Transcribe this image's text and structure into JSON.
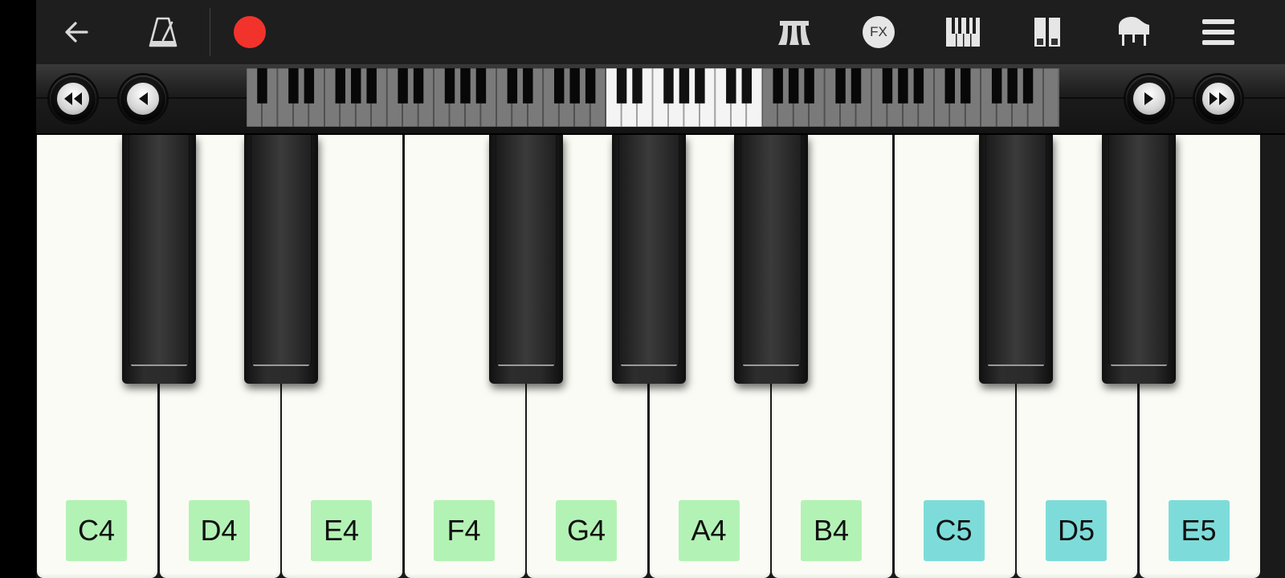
{
  "toolbar": {
    "left": [
      {
        "name": "back-arrow-icon"
      },
      {
        "name": "metronome-icon"
      },
      {
        "name": "record-button"
      }
    ],
    "right": [
      {
        "name": "pedal-sustain-icon"
      },
      {
        "name": "fx-icon",
        "label": "FX"
      },
      {
        "name": "keyboard-layout-icon"
      },
      {
        "name": "dual-keyboard-icon"
      },
      {
        "name": "grand-piano-icon"
      },
      {
        "name": "menu-icon"
      }
    ],
    "record_color": "#f2332c"
  },
  "navigator": {
    "buttons": [
      "rewind-fast",
      "rewind",
      "forward",
      "forward-fast"
    ],
    "visible_octave_range": [
      "C4",
      "E5"
    ]
  },
  "keyboard": {
    "white_keys": [
      {
        "note": "C4",
        "color": "#b3f2b5"
      },
      {
        "note": "D4",
        "color": "#b3f2b5"
      },
      {
        "note": "E4",
        "color": "#b3f2b5"
      },
      {
        "note": "F4",
        "color": "#b3f2b5"
      },
      {
        "note": "G4",
        "color": "#b3f2b5"
      },
      {
        "note": "A4",
        "color": "#b3f2b5"
      },
      {
        "note": "B4",
        "color": "#b3f2b5"
      },
      {
        "note": "C5",
        "color": "#7ddcd9"
      },
      {
        "note": "D5",
        "color": "#7ddcd9"
      },
      {
        "note": "E5",
        "color": "#7ddcd9"
      }
    ]
  }
}
